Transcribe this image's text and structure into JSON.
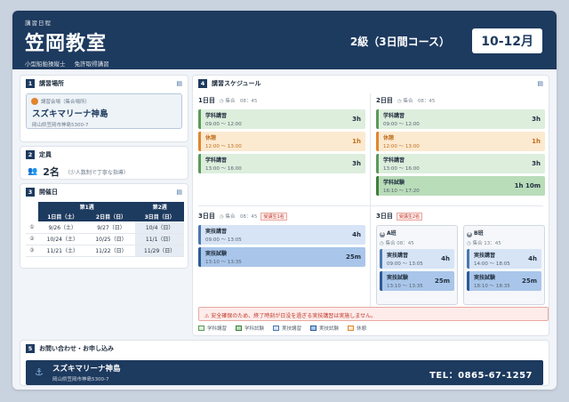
{
  "header": {
    "small": "講習日程",
    "title": "笠岡教室",
    "sub": [
      "小型船舶操縦士",
      "免許取得講習"
    ],
    "course": "2級（3日間コース）",
    "badge": "10-12月"
  },
  "place": {
    "num": "1",
    "title": "講習場所",
    "label": "講習会場（集合場所）",
    "name": "スズキマリーナ神島",
    "address": "岡山県笠岡市神島5300-7"
  },
  "capacity": {
    "num": "2",
    "title": "定員",
    "value": "2名",
    "note": "（少人数制で丁寧な指導）"
  },
  "dates": {
    "num": "3",
    "title": "開催日",
    "group_headers": [
      "第1週",
      "第2週"
    ],
    "columns": [
      "1日目（土）",
      "2日目（日）",
      "3日目（日）"
    ],
    "rows": [
      {
        "idx": "①",
        "d1": "9/26（土）",
        "d2": "9/27（日）",
        "d3": "10/4（日）"
      },
      {
        "idx": "②",
        "d1": "10/24（土）",
        "d2": "10/25（日）",
        "d3": "11/1（日）"
      },
      {
        "idx": "③",
        "d1": "11/21（土）",
        "d2": "11/22（日）",
        "d3": "11/29（日）"
      }
    ]
  },
  "schedule": {
    "num": "4",
    "title": "講習スケジュール",
    "day1": {
      "label": "1日目",
      "meet": "集合　08：45",
      "blocks": [
        {
          "title": "学科講習",
          "time": "09:00 ～ 12:00",
          "dur": "3h"
        },
        {
          "title": "休憩",
          "time": "12:00 ～ 13:00",
          "dur": "1h"
        },
        {
          "title": "学科講習",
          "time": "13:00 ～ 16:00",
          "dur": "3h"
        }
      ]
    },
    "day2": {
      "label": "2日目",
      "meet": "集合　08：45",
      "blocks": [
        {
          "title": "学科講習",
          "time": "09:00 ～ 12:00",
          "dur": "3h"
        },
        {
          "title": "休憩",
          "time": "12:00 ～ 13:00",
          "dur": "1h"
        },
        {
          "title": "学科講習",
          "time": "13:00 ～ 16:00",
          "dur": "3h"
        },
        {
          "title": "学科試験",
          "time": "16:10 ～ 17:20",
          "dur": "1h 10m"
        }
      ]
    },
    "day3a": {
      "label": "3日目",
      "meet": "集合　08：45",
      "cap": "受講生1名",
      "blocks": [
        {
          "title": "実技講習",
          "time": "09:00 ～ 13:05",
          "dur": "4h"
        },
        {
          "title": "実技試験",
          "time": "13:10 ～ 13:35",
          "dur": "25m"
        }
      ]
    },
    "day3b": {
      "label": "3日目",
      "cap": "受講生2名",
      "groupA": {
        "badge": "A",
        "name": "A班",
        "meet": "集合 08：45",
        "blocks": [
          {
            "title": "実技講習",
            "time": "09:00 ～ 13:05",
            "dur": "4h"
          },
          {
            "title": "実技試験",
            "time": "13:10 ～ 13:35",
            "dur": "25m"
          }
        ]
      },
      "groupB": {
        "badge": "B",
        "name": "B班",
        "meet": "集合 13：45",
        "blocks": [
          {
            "title": "実技講習",
            "time": "14:00 ～ 18:05",
            "dur": "4h"
          },
          {
            "title": "実技試験",
            "time": "18:10 ～ 18:35",
            "dur": "25m"
          }
        ]
      }
    },
    "warning": "⚠ 安全確保のため、終了時刻が日没を過ぎる実技講習は実施しません。",
    "legend": [
      "学科講習",
      "学科試験",
      "実技講習",
      "実技試験",
      "休憩"
    ]
  },
  "contact": {
    "num": "5",
    "title": "お問い合わせ・お申し込み",
    "name": "スズキマリーナ神島",
    "address": "岡山県笠岡市神島5300-7",
    "tel": "TEL：0865-67-1257"
  },
  "colors": {
    "navy": "#1d3a5f",
    "lecture": "#ddeedd",
    "lecture_exam": "#b9dcb9",
    "practical": "#d6e4f5",
    "practical_exam": "#a9c6ea",
    "break": "#fbe9d0",
    "warning": "#c0392b"
  },
  "icons": {
    "section": "calendar-icon",
    "pin": "location-pin-icon",
    "people": "people-icon",
    "clock": "clock-icon",
    "anchor": "anchor-icon"
  }
}
